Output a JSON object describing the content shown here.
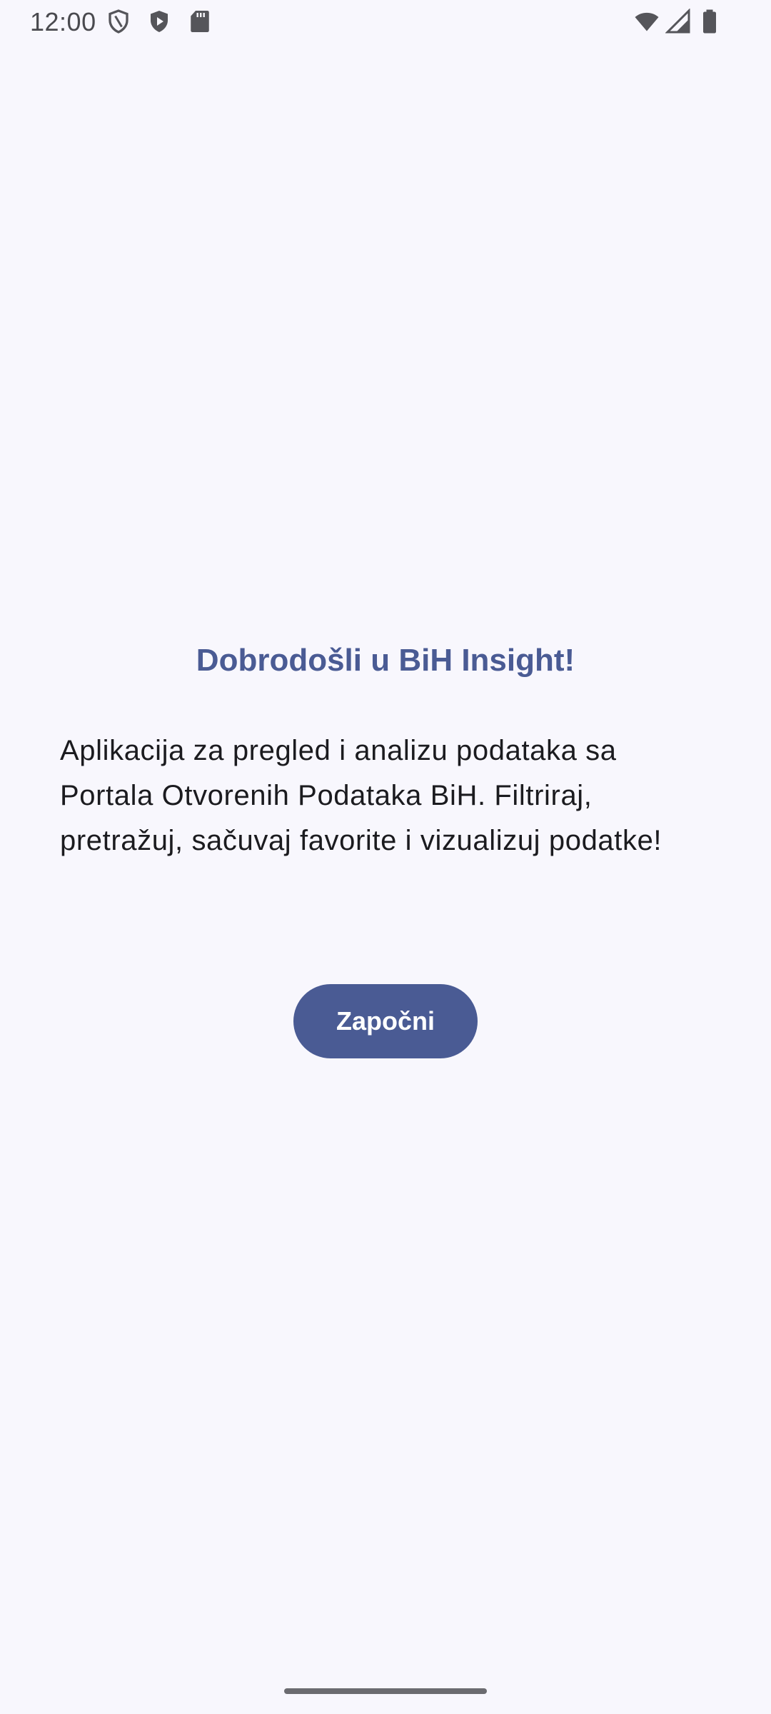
{
  "status_bar": {
    "time": "12:00",
    "icons": [
      "vpn-shield-icon",
      "play-protect-icon",
      "sd-card-icon",
      "wifi-icon",
      "signal-icon",
      "battery-icon"
    ]
  },
  "welcome": {
    "title": "Dobrodošli u BiH Insight!",
    "description": "Aplikacija za pregled i analizu podataka sa Portala Otvorenih Podataka BiH. Filtriraj, pretražuj, sačuvaj favorite i vizualizuj podatke!",
    "start_button_label": "Započni"
  },
  "colors": {
    "background": "#f8f7fd",
    "primary": "#4a5b94",
    "text": "#1b1b1f"
  }
}
